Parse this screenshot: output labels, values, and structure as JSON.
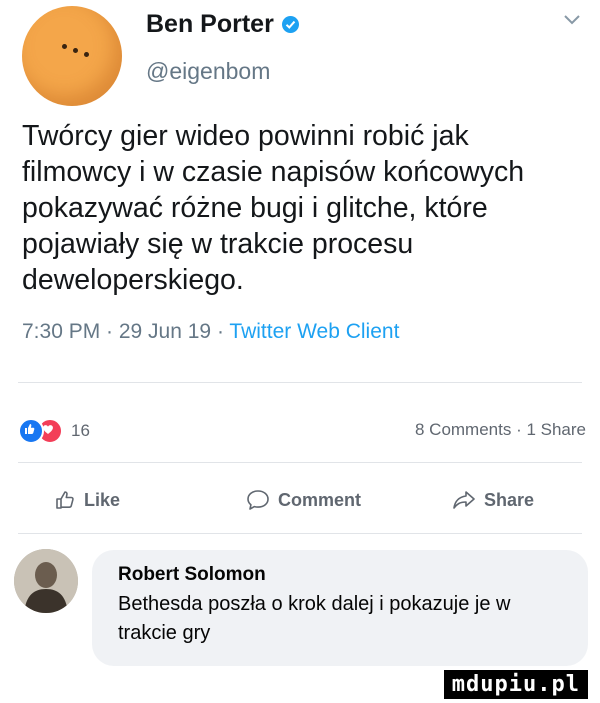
{
  "tweet": {
    "author_name": "Ben Porter",
    "handle": "@eigenbom",
    "text": "Twórcy gier wideo powinni robić jak filmowcy i w czasie napisów końcowych pokazywać różne bugi i glitche, które pojawiały się w trakcie procesu deweloperskiego.",
    "meta_time": "7:30 PM · 29 Jun 19 · ",
    "meta_client": "Twitter Web Client"
  },
  "post": {
    "reaction_count": "16",
    "counts": "8 Comments · 1 Share"
  },
  "actions": {
    "like": "Like",
    "comment": "Comment",
    "share": "Share"
  },
  "comment": {
    "author": "Robert Solomon",
    "text": "Bethesda poszła o krok dalej i pokazuje je w trakcie gry"
  },
  "watermark": "mdupiu.pl",
  "colors": {
    "twitter_blue": "#1da1f2",
    "facebook_blue": "#1877f2",
    "love_red": "#f33e58",
    "muted_gray": "#657786"
  }
}
